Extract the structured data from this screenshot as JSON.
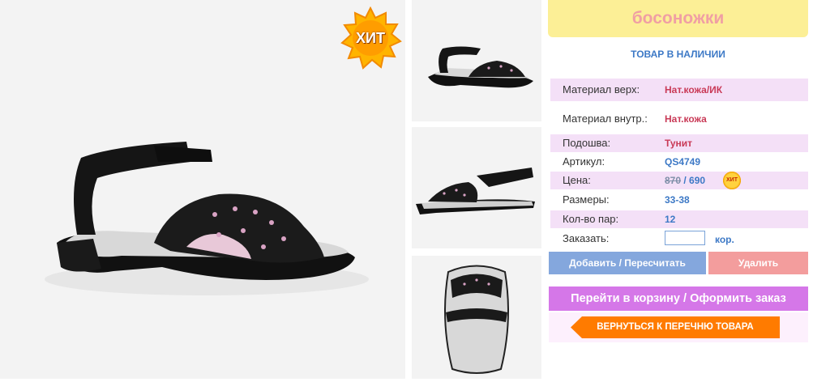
{
  "product": {
    "title": "босоножки",
    "stock_status": "ТОВАР В НАЛИЧИИ",
    "hit_badge": "ХИТ",
    "price_badge": "ХИТ"
  },
  "details": [
    {
      "label": "Материал верх:",
      "value": "Нат.кожа/ИК"
    },
    {
      "label": "Материал внутр.:",
      "value": "Нат.кожа"
    },
    {
      "label": "Подошва:",
      "value": "Тунит"
    },
    {
      "label": "Артикул:",
      "value": "QS4749"
    },
    {
      "label": "Цена:",
      "old_price": "870",
      "separator": " / ",
      "new_price": "690"
    },
    {
      "label": "Размеры:",
      "value": "33-38"
    },
    {
      "label": "Кол-во пар:",
      "value": "12"
    },
    {
      "label": "Заказать:",
      "unit": "кор."
    }
  ],
  "order": {
    "quantity_value": ""
  },
  "buttons": {
    "add": "Добавить / Пересчитать",
    "remove": "Удалить",
    "cart": "Перейти в корзину / Оформить заказ",
    "back": "ВЕРНУТЬСЯ К ПЕРЕЧНЮ ТОВАРА"
  },
  "colors": {
    "title_bg": "#fcef96",
    "accent_blue": "#3d79c6",
    "accent_red": "#c93a57",
    "cart_button": "#d577e8",
    "back_button": "#ff7b00"
  },
  "icons": [
    "hit-badge-icon",
    "sandal-photo",
    "back-arrow-icon"
  ]
}
